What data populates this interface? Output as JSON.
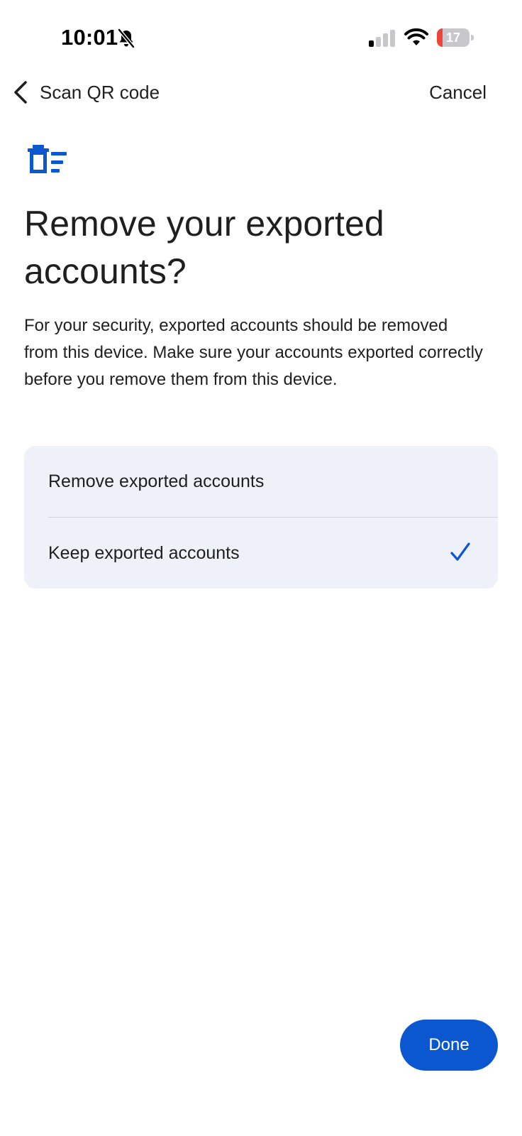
{
  "status_bar": {
    "time": "10:01",
    "battery_level": "17",
    "battery_fraction": 0.17,
    "icons": [
      "bell-off-icon",
      "cellular-signal-icon",
      "wifi-icon",
      "battery-icon"
    ]
  },
  "nav": {
    "back_label": "Scan QR code",
    "cancel_label": "Cancel",
    "back_icon": "chevron-left-icon"
  },
  "header": {
    "icon": "delete-list-icon",
    "title": "Remove your exported accounts?"
  },
  "description": "For your security, exported accounts should be removed from this device. Make sure your accounts exported correctly before you remove them from this device.",
  "options": [
    {
      "label": "Remove exported accounts",
      "selected": false
    },
    {
      "label": "Keep exported accounts",
      "selected": true
    }
  ],
  "done_label": "Done",
  "colors": {
    "accent": "#0b57d0",
    "card_background": "#eef1f7",
    "battery_low": "#f04438",
    "text": "#1f1f1f"
  }
}
